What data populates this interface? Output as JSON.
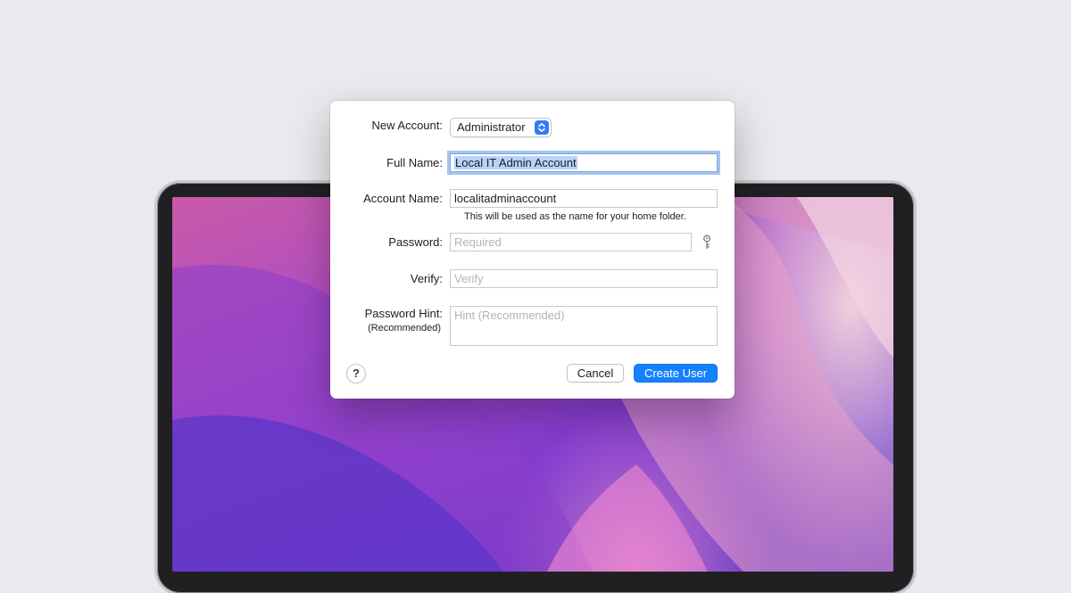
{
  "dialog": {
    "new_account": {
      "label": "New Account:",
      "value": "Administrator"
    },
    "full_name": {
      "label": "Full Name:",
      "value": "Local IT Admin Account"
    },
    "account_name": {
      "label": "Account Name:",
      "value": "localitadminaccount",
      "hint": "This will be used as the name for your home folder."
    },
    "password": {
      "label": "Password:",
      "placeholder": "Required"
    },
    "verify": {
      "label": "Verify:",
      "placeholder": "Verify"
    },
    "password_hint": {
      "label": "Password Hint:",
      "sublabel": "(Recommended)",
      "placeholder": "Hint (Recommended)"
    },
    "help_label": "?",
    "cancel_label": "Cancel",
    "create_label": "Create User"
  },
  "icons": {
    "key": "key-icon",
    "popup_arrows": "chevron-updown-icon"
  },
  "colors": {
    "accent": "#1681ff",
    "focus_ring": "#5a96e6",
    "selection": "#b6d3fb",
    "background": "#e9eaee"
  }
}
